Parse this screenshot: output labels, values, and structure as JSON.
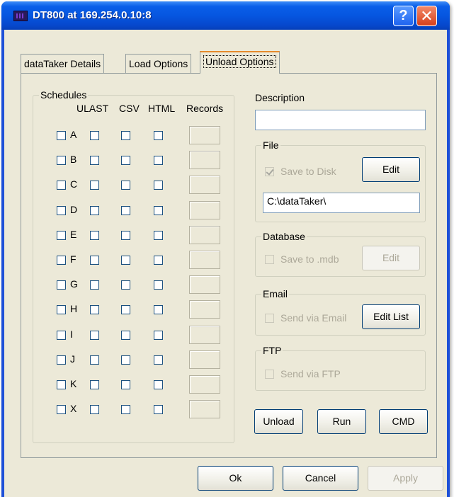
{
  "window": {
    "title": "DT800 at 169.254.0.10:8",
    "help_glyph": "?",
    "close_glyph": "✕"
  },
  "tabs": [
    {
      "label": "dataTaker Details"
    },
    {
      "label": "Load Options"
    },
    {
      "label": "Unload Options"
    }
  ],
  "schedules": {
    "group_title": "Schedules",
    "columns": [
      "ULAST",
      "CSV",
      "HTML",
      "Records"
    ],
    "rows": [
      {
        "letter": "A"
      },
      {
        "letter": "B"
      },
      {
        "letter": "C"
      },
      {
        "letter": "D"
      },
      {
        "letter": "E"
      },
      {
        "letter": "F"
      },
      {
        "letter": "G"
      },
      {
        "letter": "H"
      },
      {
        "letter": "I"
      },
      {
        "letter": "J"
      },
      {
        "letter": "K"
      },
      {
        "letter": "X"
      }
    ]
  },
  "description": {
    "label": "Description",
    "value": ""
  },
  "file": {
    "group_title": "File",
    "save_to_disk_label": "Save to Disk",
    "save_to_disk_checked": true,
    "edit_label": "Edit",
    "path_value": "C:\\dataTaker\\"
  },
  "database": {
    "group_title": "Database",
    "save_label": "Save to .mdb",
    "edit_label": "Edit"
  },
  "email": {
    "group_title": "Email",
    "send_label": "Send via Email",
    "edit_list_label": "Edit List"
  },
  "ftp": {
    "group_title": "FTP",
    "send_label": "Send via FTP"
  },
  "actions": {
    "unload_label": "Unload",
    "run_label": "Run",
    "cmd_label": "CMD"
  },
  "footer": {
    "ok_label": "Ok",
    "cancel_label": "Cancel",
    "apply_label": "Apply"
  }
}
